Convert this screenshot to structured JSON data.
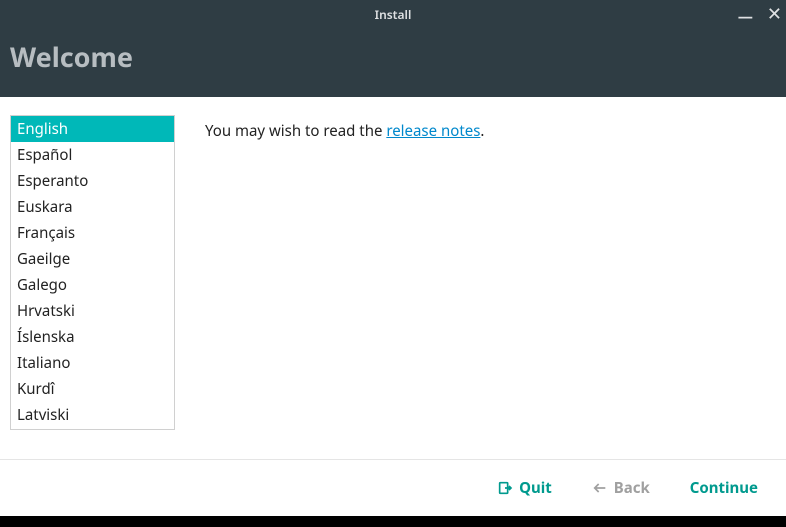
{
  "titlebar": {
    "title": "Install"
  },
  "header": {
    "title": "Welcome"
  },
  "languages": {
    "items": [
      "English",
      "Español",
      "Esperanto",
      "Euskara",
      "Français",
      "Gaeilge",
      "Galego",
      "Hrvatski",
      "Íslenska",
      "Italiano",
      "Kurdî",
      "Latviski"
    ],
    "selected_index": 0
  },
  "content": {
    "prefix": "You may wish to read the ",
    "link_text": "release notes",
    "suffix": "."
  },
  "footer": {
    "quit": "Quit",
    "back": "Back",
    "continue": "Continue"
  }
}
